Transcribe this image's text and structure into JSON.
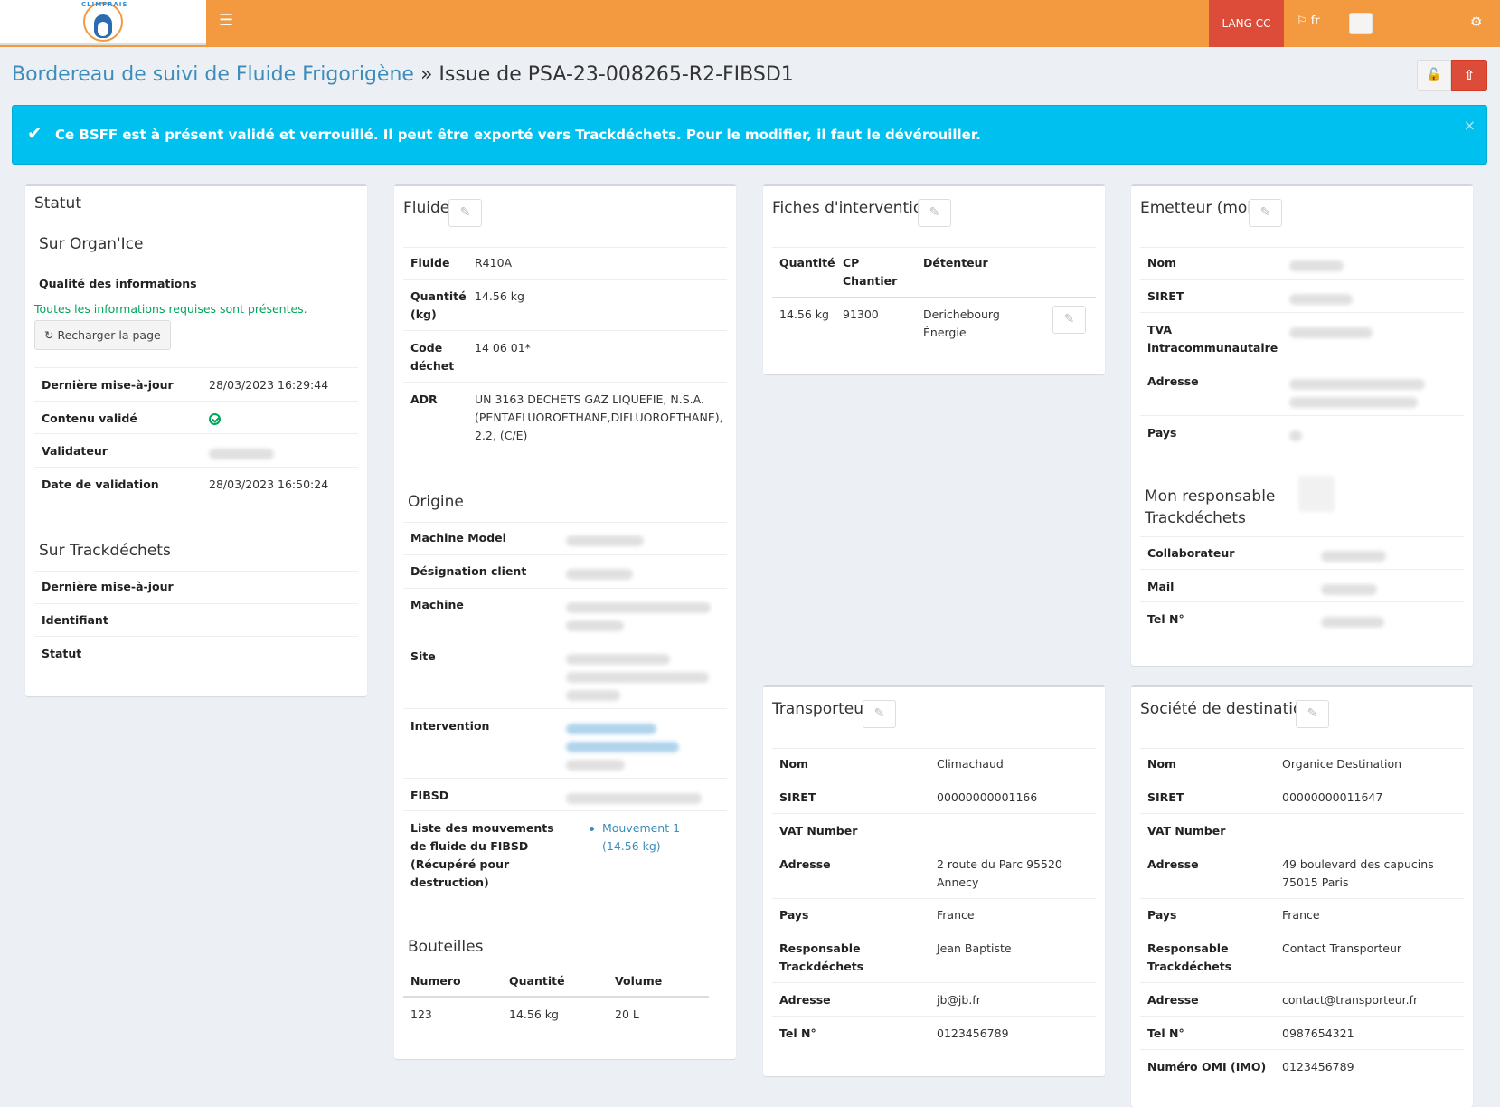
{
  "navbar": {
    "logo_text": "CLIMFRAIS",
    "menu_icon": "hamburger-icon",
    "lang_cc": "LANG CC",
    "lang": "fr",
    "flag_icon": "flag-icon",
    "settings_icon": "gears-icon"
  },
  "header": {
    "breadcrumb": "Bordereau de suivi de Fluide Frigorigène",
    "separator": " » ",
    "title": "Issue de PSA-23-008265-R2-FIBSD1",
    "unlock_icon": "unlock-icon",
    "export_icon": "upload-icon"
  },
  "alert": {
    "icon": "check-icon",
    "message": "Ce BSFF est à présent validé et verrouillé. Il peut être exporté vers Trackdéchets. Pour le modifier, il faut le dévérouiller.",
    "close": "×"
  },
  "statut": {
    "title": "Statut",
    "organice_title": "Sur Organ'Ice",
    "quality_label": "Qualité des informations",
    "quality_message": "Toutes les informations requises sont présentes.",
    "reload_button": "Recharger la page",
    "rows": [
      {
        "label": "Dernière mise-à-jour",
        "value": "28/03/2023 16:29:44"
      },
      {
        "label": "Contenu validé",
        "value": ""
      },
      {
        "label": "Validateur",
        "value": ""
      },
      {
        "label": "Date de validation",
        "value": "28/03/2023 16:50:24"
      }
    ],
    "trackdechets_title": "Sur Trackdéchets",
    "td_rows": [
      {
        "label": "Dernière mise-à-jour"
      },
      {
        "label": "Identifiant"
      },
      {
        "label": "Statut"
      }
    ]
  },
  "fluide": {
    "title": "Fluide",
    "rows": [
      {
        "label": "Fluide",
        "value": "R410A"
      },
      {
        "label": "Quantité (kg)",
        "value": "14.56 kg"
      },
      {
        "label": "Code déchet",
        "value": "14 06 01*"
      },
      {
        "label": "ADR",
        "value": "UN 3163 DECHETS GAZ LIQUEFIE, N.S.A. (PENTAFLUOROETHANE,DIFLUOROETHANE), 2.2, (C/E)"
      }
    ],
    "origine_title": "Origine",
    "origine_rows": [
      {
        "label": "Machine Model"
      },
      {
        "label": "Désignation client"
      },
      {
        "label": "Machine"
      },
      {
        "label": "Site"
      },
      {
        "label": "Intervention"
      },
      {
        "label": "FIBSD"
      },
      {
        "label": "Liste des mouvements de fluide du FIBSD (Récupéré pour destruction)"
      }
    ],
    "movement_link": "Mouvement 1 (14.56 kg)",
    "bouteilles_title": "Bouteilles",
    "bouteilles_headers": [
      "Numero",
      "Quantité",
      "Volume"
    ],
    "bouteilles_rows": [
      [
        "123",
        "14.56 kg",
        "20 L"
      ]
    ]
  },
  "fiches": {
    "title": "Fiches d'intervention",
    "headers": [
      "Quantité",
      "CP Chantier",
      "Détenteur"
    ],
    "rows": [
      {
        "quantite": "14.56 kg",
        "cp": "91300",
        "detenteur": "Derichebourg Énergie"
      }
    ]
  },
  "emetteur": {
    "title": "Emetteur (moi)",
    "rows": [
      {
        "label": "Nom"
      },
      {
        "label": "SIRET"
      },
      {
        "label": "TVA intracommunautaire"
      },
      {
        "label": "Adresse"
      },
      {
        "label": "Pays"
      }
    ],
    "resp_title": "Mon responsable Trackdéchets",
    "resp_rows": [
      {
        "label": "Collaborateur"
      },
      {
        "label": "Mail"
      },
      {
        "label": "Tel N°"
      }
    ]
  },
  "transporteur": {
    "title": "Transporteur",
    "rows": [
      {
        "label": "Nom",
        "value": "Climachaud"
      },
      {
        "label": "SIRET",
        "value": "00000000001166"
      },
      {
        "label": "VAT Number",
        "value": ""
      },
      {
        "label": "Adresse",
        "value": "2 route du Parc 95520 Annecy"
      },
      {
        "label": "Pays",
        "value": "France"
      },
      {
        "label": "Responsable Trackdéchets",
        "value": "Jean Baptiste"
      },
      {
        "label": "Adresse",
        "value": "jb@jb.fr"
      },
      {
        "label": "Tel N°",
        "value": "0123456789"
      }
    ]
  },
  "destination": {
    "title": "Société de destination",
    "rows": [
      {
        "label": "Nom",
        "value": "Organice Destination"
      },
      {
        "label": "SIRET",
        "value": "00000000011647"
      },
      {
        "label": "VAT Number",
        "value": ""
      },
      {
        "label": "Adresse",
        "value": "49 boulevard des capucins 75015 Paris"
      },
      {
        "label": "Pays",
        "value": "France"
      },
      {
        "label": "Responsable Trackdéchets",
        "value": "Contact Transporteur"
      },
      {
        "label": "Adresse",
        "value": "contact@transporteur.fr"
      },
      {
        "label": "Tel N°",
        "value": "0987654321"
      },
      {
        "label": "Numéro OMI (IMO)",
        "value": "0123456789"
      }
    ]
  }
}
